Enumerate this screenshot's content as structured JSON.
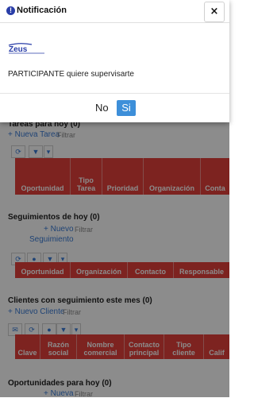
{
  "modal": {
    "title": "Notificación",
    "close_label": "×",
    "logo_text": "Zeus",
    "message": "PARTICIPANTE quiere supervisarte",
    "no_label": "No",
    "si_label": "Si"
  },
  "tareas": {
    "title": "Tareas para hoy (0)",
    "nuevo": "+ Nueva Tarea",
    "filtrar": "Filtrar",
    "columns": [
      {
        "top": "",
        "bottom": "Oportunidad"
      },
      {
        "top": "Tipo",
        "bottom": "Tarea"
      },
      {
        "top": "",
        "bottom": "Prioridad"
      },
      {
        "top": "",
        "bottom": "Organización"
      },
      {
        "top": "",
        "bottom": "Conta"
      }
    ]
  },
  "seguimientos": {
    "title": "Seguimientos de hoy (0)",
    "nuevo": "+ Nuevo",
    "filtrar": "Filtrar",
    "sub": "Seguimiento",
    "columns": [
      {
        "top": "",
        "bottom": "Oportunidad"
      },
      {
        "top": "",
        "bottom": "Organización"
      },
      {
        "top": "",
        "bottom": "Contacto"
      },
      {
        "top": "",
        "bottom": "Responsable"
      }
    ]
  },
  "clientes": {
    "title": "Clientes con seguimiento este mes (0)",
    "nuevo": "+ Nuevo Cliente",
    "filtrar": "Filtrar",
    "columns": [
      {
        "top": "",
        "bottom": "Clave"
      },
      {
        "top": "Razón",
        "bottom": "social"
      },
      {
        "top": "Nombre",
        "bottom": "comercial"
      },
      {
        "top": "Contacto",
        "bottom": "principal"
      },
      {
        "top": "Tipo",
        "bottom": "cliente"
      },
      {
        "top": "",
        "bottom": "Calif"
      }
    ]
  },
  "oportunidades": {
    "title": "Oportunidades para hoy (0)",
    "nuevo": "+ Nueva",
    "filtrar": "Filtrar"
  },
  "colors": {
    "table_header": "#e3403b",
    "link": "#3a7bd5",
    "primary_button": "#3d8fd9"
  }
}
